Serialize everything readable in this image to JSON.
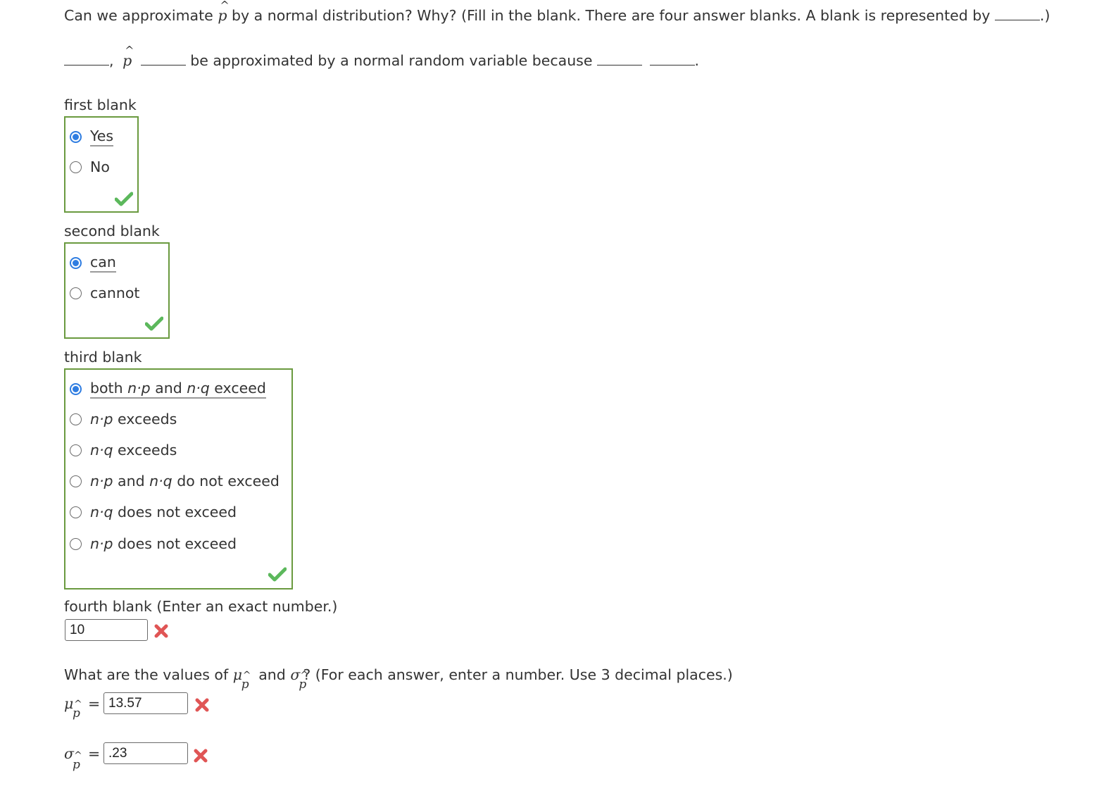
{
  "question": {
    "prefix": "Can we approximate",
    "suffix": "by a normal distribution? Why? (Fill in the blank. There are four answer blanks. A blank is represented by",
    "end": ".)",
    "phat_symbol": "p",
    "hat": "^"
  },
  "sentence": {
    "comma": ",",
    "middle": "be approximated by a normal random variable because",
    "period": "."
  },
  "blanks": [
    {
      "label": "first blank",
      "options": [
        {
          "label": "Yes",
          "selected": true
        },
        {
          "label": "No",
          "selected": false
        }
      ],
      "status": "correct"
    },
    {
      "label": "second blank",
      "options": [
        {
          "label": "can",
          "selected": true
        },
        {
          "label": "cannot",
          "selected": false
        }
      ],
      "status": "correct"
    },
    {
      "label": "third blank",
      "options": [
        {
          "label": "both n·p and n·q exceed",
          "selected": true
        },
        {
          "label": "n·p exceeds",
          "selected": false
        },
        {
          "label": "n·q exceeds",
          "selected": false
        },
        {
          "label": "n·p and n·q do not exceed",
          "selected": false
        },
        {
          "label": "n·q does not exceed",
          "selected": false
        },
        {
          "label": "n·p does not exceed",
          "selected": false
        }
      ],
      "status": "correct"
    },
    {
      "label": "fourth blank (Enter an exact number.)",
      "value": "10",
      "status": "incorrect"
    }
  ],
  "third_parts": {
    "o0": {
      "a": "both ",
      "b": "n·p",
      "c": " and ",
      "d": "n·q",
      "e": " exceed"
    },
    "o1": {
      "b": "n·p",
      "e": " exceeds"
    },
    "o2": {
      "b": "n·q",
      "e": " exceeds"
    },
    "o3": {
      "b": "n·p",
      "c": " and ",
      "d": "n·q",
      "e": " do not exceed"
    },
    "o4": {
      "b": "n·q",
      "e": " does not exceed"
    },
    "o5": {
      "b": "n·p",
      "e": " does not exceed"
    }
  },
  "values_question": {
    "prefix": "What are the values of",
    "mu": "μ",
    "and": "and",
    "sigma": "σ",
    "suffix": "? (For each answer, enter a number. Use 3 decimal places.)",
    "equals": "="
  },
  "answers": {
    "mu": {
      "value": "13.57",
      "status": "incorrect"
    },
    "sigma": {
      "value": ".23",
      "status": "incorrect"
    }
  },
  "colors": {
    "correct_border": "#6a9a3f",
    "radio_selected": "#2f7de1",
    "check": "#5cb85c",
    "cross": "#e05555"
  }
}
